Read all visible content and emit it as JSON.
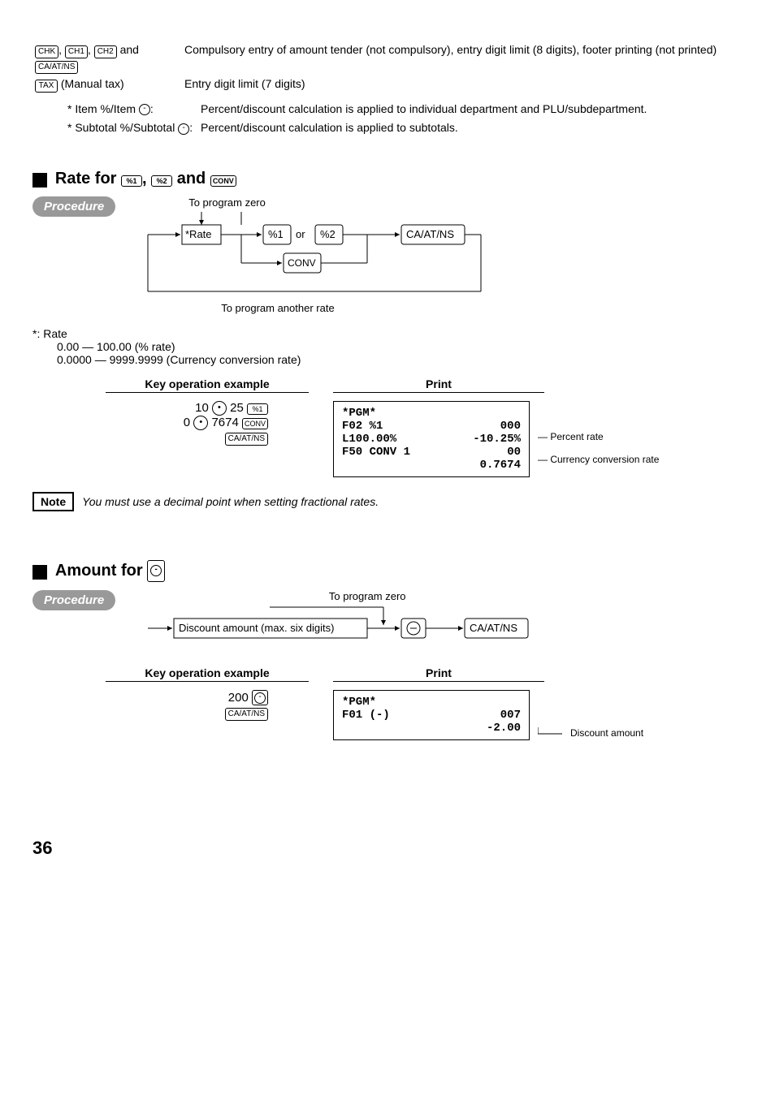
{
  "spec_rows": [
    {
      "key_labels": [
        "CHK",
        "CH1",
        "CH2",
        "CA/AT/NS"
      ],
      "key_joiner": ", ",
      "key_and": " and ",
      "desc": "Compulsory entry of amount tender (not compulsory), entry digit limit (8 digits), footer printing (not printed)"
    },
    {
      "key_labels": [
        "TAX"
      ],
      "suffix": " (Manual tax)",
      "desc": "Entry digit limit (7 digits)"
    }
  ],
  "stars": [
    {
      "label": "* Item %/Item ⊖:",
      "desc": "Percent/discount calculation is applied to individual department and PLU/subdepartment."
    },
    {
      "label": "* Subtotal %/Subtotal ⊖:",
      "desc": "Percent/discount calculation is applied to subtotals."
    }
  ],
  "rate_section": {
    "title_prefix": "Rate for ",
    "keys": [
      "%1",
      "%2",
      "CONV"
    ],
    "joiner": ", ",
    "and": " and ",
    "procedure_label": "Procedure",
    "to_program_zero": "To program zero",
    "to_program_another": "To program another rate",
    "rate_box": "*Rate",
    "pct1": "%1",
    "or": " or ",
    "pct2": "%2",
    "conv": "CONV",
    "caatns": "CA/AT/NS",
    "rate_info_head": "*:  Rate",
    "rate_info_1": "0.00 — 100.00 (% rate)",
    "rate_info_2": "0.0000 — 9999.9999 (Currency conversion rate)"
  },
  "cols": {
    "a": "Key operation example",
    "b": "Print"
  },
  "rate_keyop": {
    "line1_a": "10",
    "line1_b": "25",
    "line1_key": "%1",
    "line2_a": "0",
    "line2_b": "7674",
    "line2_key": "CONV",
    "line3_key": "CA/AT/NS"
  },
  "rate_print": {
    "l1": "*PGM*",
    "l2a": "F02 %1",
    "l2b": "000",
    "l3a": "L100.00%",
    "l3b": "-10.25%",
    "l4a": "F50 CONV 1",
    "l4b": "00",
    "l5b": "0.7674",
    "ann1": "Percent rate",
    "ann2": "Currency conversion rate"
  },
  "note": {
    "label": "Note",
    "text": "You must use a decimal point when setting fractional rates."
  },
  "amount_section": {
    "title": "Amount for ",
    "procedure_label": "Procedure",
    "to_program_zero": "To program zero",
    "box": "Discount amount (max. six digits)",
    "caatns": "CA/AT/NS"
  },
  "amount_keyop": {
    "line1_a": "200",
    "line2_key": "CA/AT/NS"
  },
  "amount_print": {
    "l1": "*PGM*",
    "l2a": "F01  (-)",
    "l2b": "007",
    "l3b": "-2.00",
    "ann": "Discount amount"
  },
  "page_number": "36"
}
